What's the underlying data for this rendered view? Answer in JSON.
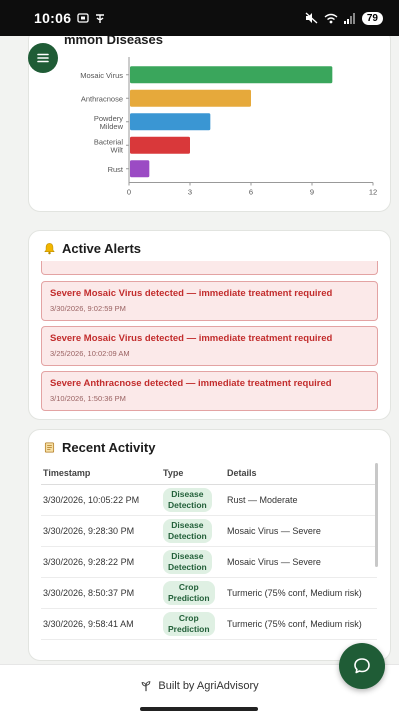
{
  "status_bar": {
    "time": "10:06",
    "battery": "79"
  },
  "chart": {
    "title_partial": "mmon Diseases",
    "bar_colors": [
      "#3aa65c",
      "#e6a93b",
      "#3a96d3",
      "#d9383a",
      "#9b4bc4"
    ]
  },
  "chart_data": {
    "type": "bar",
    "orientation": "horizontal",
    "title": "Common Diseases",
    "categories": [
      "Mosaic Virus",
      "Anthracnose",
      "Powdery Mildew",
      "Bacterial Wilt",
      "Rust"
    ],
    "values": [
      10,
      6,
      4,
      3,
      1
    ],
    "xlim": [
      0,
      12
    ],
    "xticks": [
      0,
      3,
      6,
      9,
      12
    ],
    "grid": false
  },
  "alerts": {
    "title": "Active Alerts",
    "items": [
      {
        "message": "Severe Mosaic Virus detected — immediate treatment required",
        "timestamp": "3/30/2026, 9:02:59 PM"
      },
      {
        "message": "Severe Mosaic Virus detected — immediate treatment required",
        "timestamp": "3/25/2026, 10:02:09 AM"
      },
      {
        "message": "Severe Anthracnose detected — immediate treatment required",
        "timestamp": "3/10/2026, 1:50:36 PM"
      }
    ]
  },
  "activity": {
    "title": "Recent Activity",
    "columns": [
      "Timestamp",
      "Type",
      "Details"
    ],
    "rows": [
      {
        "timestamp": "3/30/2026, 10:05:22 PM",
        "type_l1": "Disease",
        "type_l2": "Detection",
        "details": "Rust — Moderate"
      },
      {
        "timestamp": "3/30/2026, 9:28:30 PM",
        "type_l1": "Disease",
        "type_l2": "Detection",
        "details": "Mosaic Virus — Severe"
      },
      {
        "timestamp": "3/30/2026, 9:28:22 PM",
        "type_l1": "Disease",
        "type_l2": "Detection",
        "details": "Mosaic Virus — Severe"
      },
      {
        "timestamp": "3/30/2026, 8:50:37 PM",
        "type_l1": "Crop",
        "type_l2": "Prediction",
        "details": "Turmeric (75% conf, Medium risk)"
      },
      {
        "timestamp": "3/30/2026, 9:58:41 AM",
        "type_l1": "Crop",
        "type_l2": "Prediction",
        "details": "Turmeric (75% conf, Medium risk)"
      }
    ]
  },
  "footer": {
    "text": "Built by AgriAdvisory"
  },
  "colors": {
    "brand": "#1f5c36",
    "alert_text": "#c22d2d",
    "alert_bg": "#fbe9e9",
    "badge_bg": "#dff0e3"
  }
}
